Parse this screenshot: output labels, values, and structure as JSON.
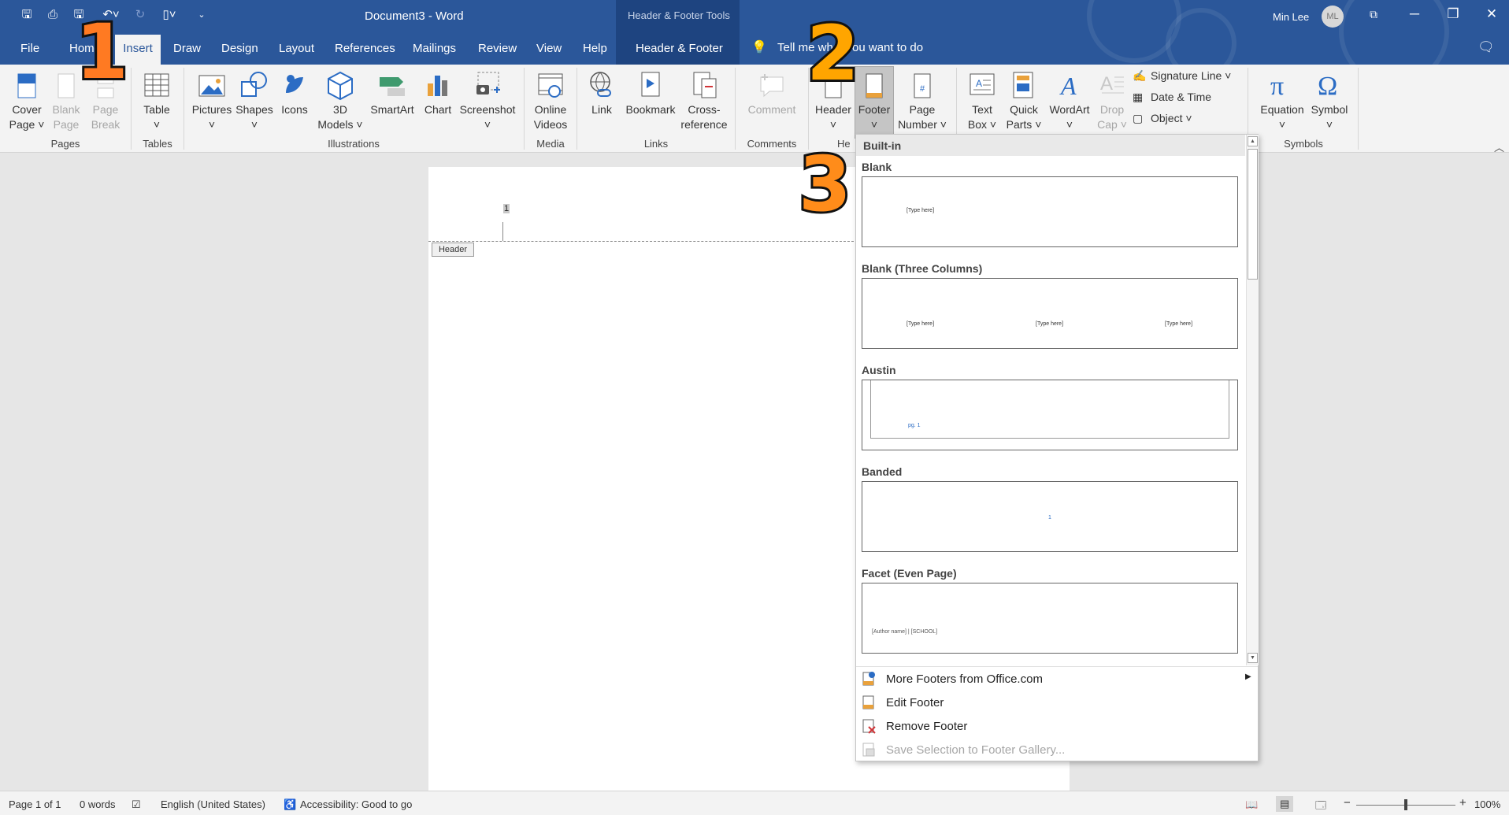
{
  "titlebar": {
    "doc_title": "Document3  -  Word",
    "context_label": "Header & Footer Tools",
    "user_name": "Min Lee",
    "avatar_initials": "ML"
  },
  "tabs": {
    "file": "File",
    "home": "Home",
    "insert": "Insert",
    "draw": "Draw",
    "design": "Design",
    "layout": "Layout",
    "references": "References",
    "mailings": "Mailings",
    "review": "Review",
    "view": "View",
    "help": "Help",
    "header_footer": "Header & Footer",
    "tell_me": "Tell me what you want to do"
  },
  "ribbon": {
    "cover_page": [
      "Cover",
      "Page ˅"
    ],
    "blank_page": [
      "Blank",
      "Page"
    ],
    "page_break": [
      "Page",
      "Break"
    ],
    "table": [
      "Table",
      "˅"
    ],
    "pictures": [
      "Pictures",
      "˅"
    ],
    "shapes": [
      "Shapes",
      "˅"
    ],
    "icons": [
      "Icons",
      ""
    ],
    "models_3d": [
      "3D",
      "Models ˅"
    ],
    "smartart": [
      "SmartArt",
      ""
    ],
    "chart": [
      "Chart",
      ""
    ],
    "screenshot": [
      "Screenshot",
      "˅"
    ],
    "online_videos": [
      "Online",
      "Videos"
    ],
    "link": [
      "Link",
      ""
    ],
    "bookmark": [
      "Bookmark",
      ""
    ],
    "cross_reference": [
      "Cross-",
      "reference"
    ],
    "comment": [
      "Comment",
      ""
    ],
    "header": [
      "Header",
      "˅"
    ],
    "footer": [
      "Footer",
      "˅"
    ],
    "page_number": [
      "Page",
      "Number ˅"
    ],
    "text_box": [
      "Text",
      "Box ˅"
    ],
    "quick_parts": [
      "Quick",
      "Parts ˅"
    ],
    "wordart": [
      "WordArt",
      "˅"
    ],
    "drop_cap": [
      "Drop",
      "Cap ˅"
    ],
    "signature_line": "Signature Line  ˅",
    "date_time": "Date & Time",
    "object": "Object  ˅",
    "equation": [
      "Equation",
      "˅"
    ],
    "symbol": [
      "Symbol",
      "˅"
    ],
    "groups": {
      "pages": "Pages",
      "tables": "Tables",
      "illustrations": "Illustrations",
      "media": "Media",
      "links": "Links",
      "comments": "Comments",
      "header_footer": "He",
      "symbols": "Symbols"
    }
  },
  "document": {
    "header_tag": "Header",
    "page_number": "1"
  },
  "footer_gallery": {
    "section": "Built-in",
    "items": [
      {
        "name": "Blank",
        "texts": [
          "[Type here]"
        ]
      },
      {
        "name": "Blank (Three Columns)",
        "texts": [
          "[Type here]",
          "[Type here]",
          "[Type here]"
        ]
      },
      {
        "name": "Austin",
        "texts": [
          "pg. 1"
        ]
      },
      {
        "name": "Banded",
        "texts": [
          "1"
        ]
      },
      {
        "name": "Facet (Even Page)",
        "texts": [
          "[Author name]  |  [SCHOOL]"
        ]
      }
    ],
    "menu": [
      {
        "label": "More Footers from Office.com",
        "enabled": true
      },
      {
        "label": "Edit Footer",
        "enabled": true
      },
      {
        "label": "Remove Footer",
        "enabled": true
      },
      {
        "label": "Save Selection to Footer Gallery...",
        "enabled": false
      }
    ]
  },
  "steps": [
    "1",
    "2",
    "3"
  ],
  "statusbar": {
    "page": "Page 1 of 1",
    "words": "0 words",
    "language": "English (United States)",
    "accessibility": "Accessibility: Good to go",
    "zoom": "100%",
    "zoom_level": 1.0
  },
  "colors": {
    "accent": "#2b579a",
    "step_number": "#ff8c00"
  }
}
